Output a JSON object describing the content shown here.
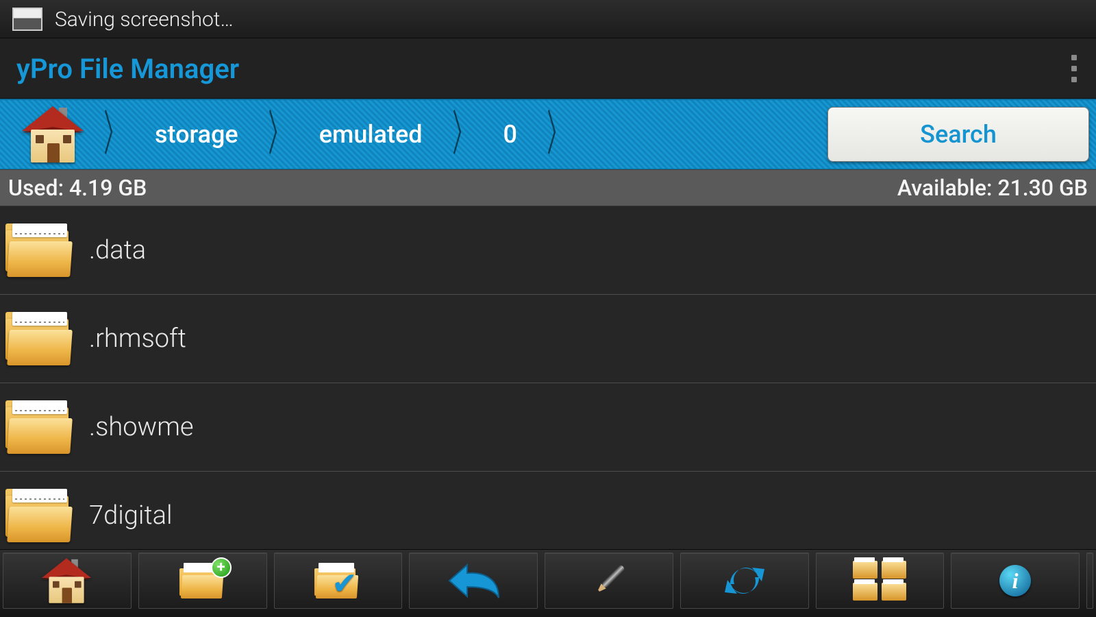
{
  "status_bar": {
    "text": "Saving screenshot…"
  },
  "title_bar": {
    "title": "yPro File Manager"
  },
  "breadcrumb": {
    "items": [
      "storage",
      "emulated",
      "0"
    ],
    "search_label": "Search"
  },
  "storage": {
    "used": "Used: 4.19 GB",
    "available": "Available: 21.30 GB"
  },
  "files": [
    {
      "name": ".data"
    },
    {
      "name": ".rhmsoft"
    },
    {
      "name": ".showme"
    },
    {
      "name": "7digital"
    }
  ],
  "toolbar": {
    "home": "home-icon",
    "new_folder": "new-folder-icon",
    "select": "select-folder-icon",
    "back": "back-arrow-icon",
    "edit": "edit-pen-icon",
    "refresh": "refresh-icon",
    "multi": "multi-folder-icon",
    "info": "info-icon"
  }
}
